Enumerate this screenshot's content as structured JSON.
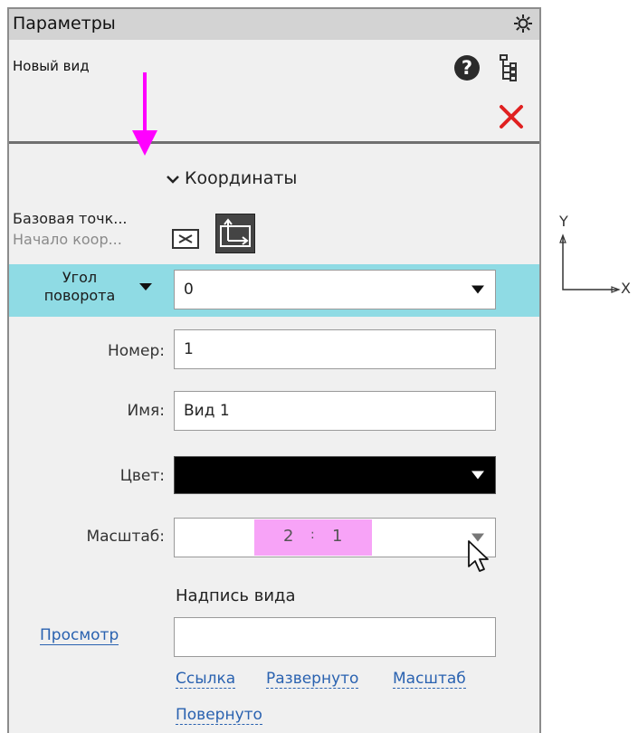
{
  "panel": {
    "title": "Параметры",
    "view_name": "Новый вид",
    "section_title": "Координаты"
  },
  "base_point": {
    "line1": "Базовая точк...",
    "line2": "Начало коор..."
  },
  "rotation": {
    "label": "Угол поворота",
    "value": "0"
  },
  "number": {
    "label": "Номер:",
    "value": "1"
  },
  "name": {
    "label": "Имя:",
    "value": "Вид 1"
  },
  "color": {
    "label": "Цвет:",
    "value": "#000000"
  },
  "scale": {
    "label": "Масштаб:",
    "numerator": "2",
    "separator": ":",
    "denominator": "1"
  },
  "caption": {
    "title": "Надпись вида",
    "preview_label": "Просмотр",
    "preview_value": "",
    "tokens": [
      "Ссылка",
      "Развернуто",
      "Масштаб",
      "Повернуто"
    ]
  },
  "canvas_axes": {
    "y": "Y",
    "x": "X"
  },
  "colors": {
    "highlight_row": "#8fdbe4",
    "close": "#e02020",
    "annotation_arrow": "#ff00ff",
    "scale_highlight": "#f7a3f7"
  }
}
